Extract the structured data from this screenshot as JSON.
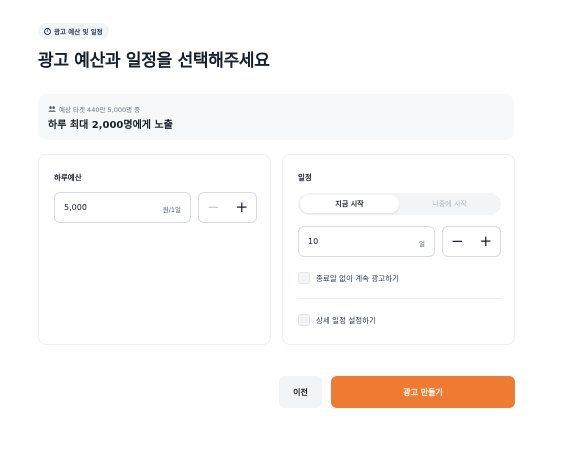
{
  "header": {
    "badge": "광고 예산 및 일정",
    "badge_icon": "question-circle-icon",
    "title": "광고 예산과 일정을 선택해주세요"
  },
  "reach": {
    "icon": "people-icon",
    "sub": "예상 타겟 440만 5,000명 중",
    "main": "하루 최대 2,000명에게 노출"
  },
  "budget": {
    "label": "하루예산",
    "value": "5,000",
    "unit": "원/1일",
    "minus": "−",
    "plus": "+"
  },
  "schedule": {
    "label": "일정",
    "start_now": "지금 시작",
    "start_later": "나중에 시작",
    "days_value": "10",
    "days_unit": "일",
    "minus": "−",
    "plus": "+",
    "no_end_label": "종료일 없이 계속 광고하기",
    "detail_label": "상세 일정 설정하기"
  },
  "footer": {
    "prev_label": "이전",
    "create_label": "광고 만들기"
  },
  "colors": {
    "accent": "#ef7a32",
    "text": "#191f28",
    "muted": "#6b7684"
  }
}
